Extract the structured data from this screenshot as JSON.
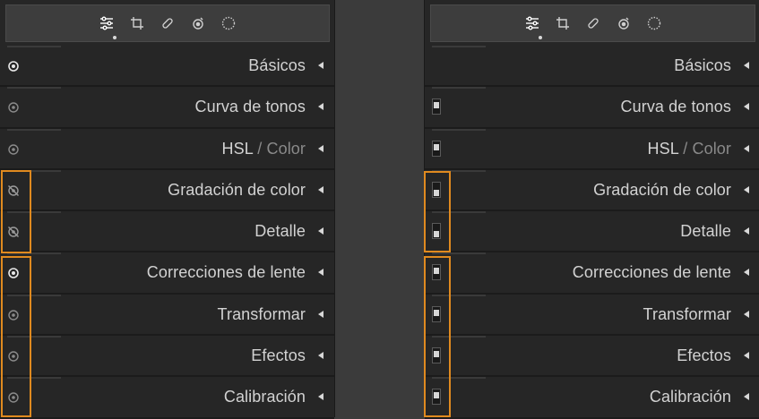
{
  "toolbar": {
    "tools": [
      {
        "name": "edit-sliders-icon",
        "active": true
      },
      {
        "name": "crop-icon",
        "active": false
      },
      {
        "name": "healing-bandage-icon",
        "active": false
      },
      {
        "name": "red-eye-icon",
        "active": false
      },
      {
        "name": "masking-icon",
        "active": false
      }
    ]
  },
  "left_panel": {
    "sections": [
      {
        "title": "Básicos",
        "visibility": "visible-bright"
      },
      {
        "title": "Curva de tonos",
        "visibility": "visible-dim"
      },
      {
        "title_main": "HSL",
        "title_sep": "/",
        "title_alt": "Color",
        "visibility": "visible-dim"
      },
      {
        "title": "Gradación de color",
        "visibility": "hidden"
      },
      {
        "title": "Detalle",
        "visibility": "hidden"
      },
      {
        "title": "Correcciones de lente",
        "visibility": "visible-bright"
      },
      {
        "title": "Transformar",
        "visibility": "visible-dim"
      },
      {
        "title": "Efectos",
        "visibility": "visible-dim"
      },
      {
        "title": "Calibración",
        "visibility": "visible-dim"
      }
    ]
  },
  "right_panel": {
    "sections": [
      {
        "title": "Básicos",
        "switch": "none"
      },
      {
        "title": "Curva de tonos",
        "switch": "on"
      },
      {
        "title_main": "HSL",
        "title_sep": "/",
        "title_alt": "Color",
        "switch": "on"
      },
      {
        "title": "Gradación de color",
        "switch": "off"
      },
      {
        "title": "Detalle",
        "switch": "off"
      },
      {
        "title": "Correcciones de lente",
        "switch": "on"
      },
      {
        "title": "Transformar",
        "switch": "on"
      },
      {
        "title": "Efectos",
        "switch": "on"
      },
      {
        "title": "Calibración",
        "switch": "on"
      }
    ]
  },
  "colors": {
    "panel_bg": "#262626",
    "highlight": "#e08a1f",
    "text": "#d2d2d2"
  }
}
